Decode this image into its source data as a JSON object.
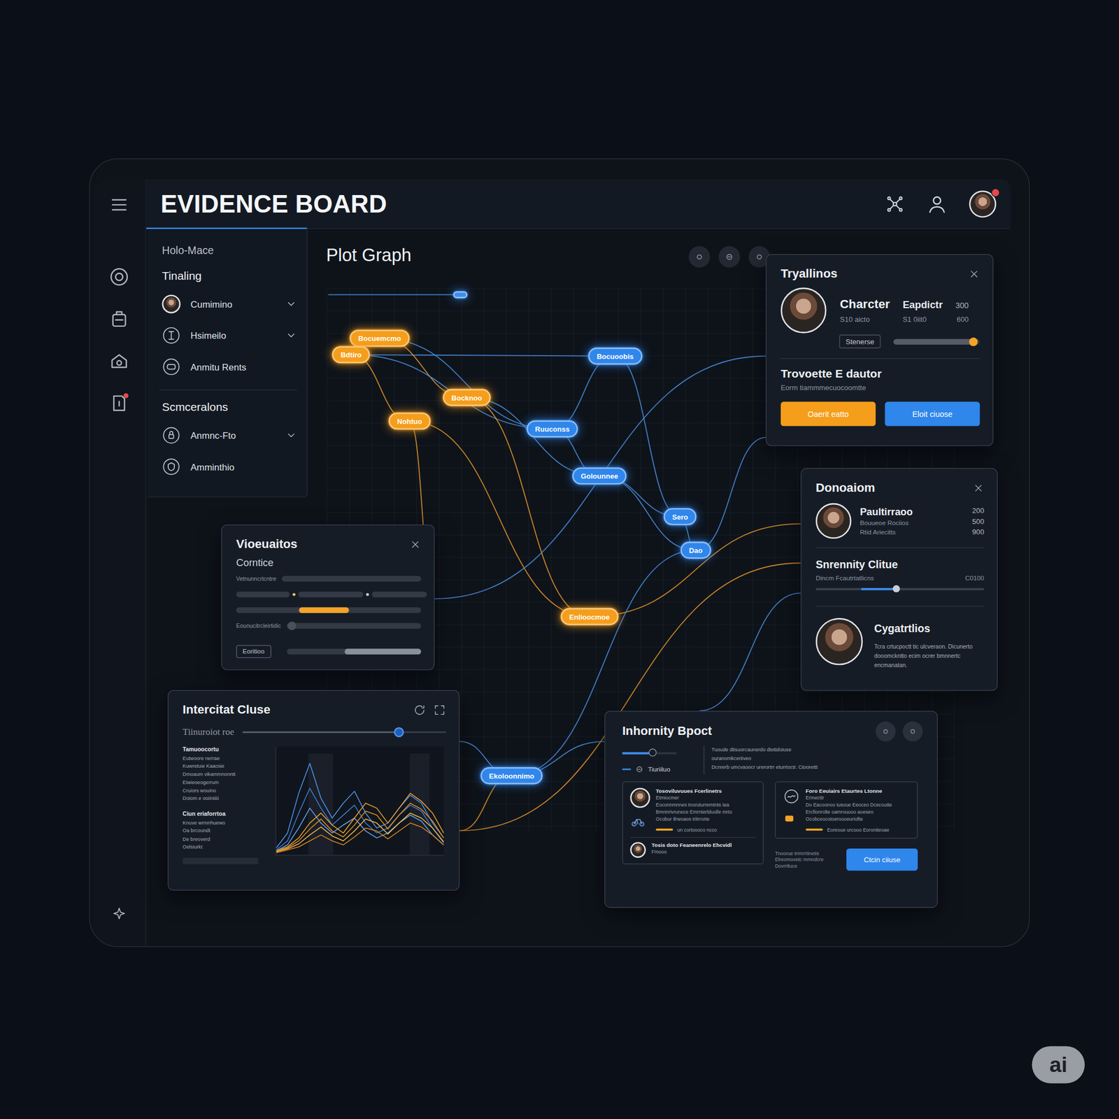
{
  "window": {
    "title": "EVIDENCE BOARD"
  },
  "header": {
    "notification": true
  },
  "rail": {
    "items": [
      {
        "selected": false,
        "alert": false
      },
      {
        "selected": false,
        "alert": false
      },
      {
        "selected": false,
        "alert": false
      },
      {
        "selected": false,
        "alert": true
      }
    ]
  },
  "panel": {
    "items": [
      {
        "kind": "caption",
        "label": "Holo-Mace"
      },
      {
        "kind": "heading",
        "label": "Tinaling"
      },
      {
        "kind": "avatar",
        "label": "Cumimino",
        "expanded": false
      },
      {
        "kind": "entry",
        "label": "Hsimeilo",
        "expanded": false
      },
      {
        "kind": "entry",
        "label": "Anmitu Rents"
      },
      {
        "kind": "divider"
      },
      {
        "kind": "heading",
        "label": "Scmceralons"
      },
      {
        "kind": "entry",
        "label": "Anmnc-Fto",
        "expanded": false
      },
      {
        "kind": "entry",
        "label": "Amminthio"
      }
    ]
  },
  "graph": {
    "title": "Plot Graph",
    "nodes": [
      {
        "kind": "dot",
        "color": "#3b8ef0"
      },
      {
        "kind": "pill",
        "label": "Bocuemcmo",
        "color": "#f59e1b"
      },
      {
        "kind": "pill",
        "label": "Bdtiro",
        "color": "#f59e1b"
      },
      {
        "kind": "pill",
        "label": "Bocknoo",
        "color": "#f59e1b"
      },
      {
        "kind": "pill",
        "label": "Nohtuo",
        "color": "#f59e1b"
      },
      {
        "kind": "pill",
        "label": "Bocuoobis",
        "color": "#2f86eb"
      },
      {
        "kind": "pill",
        "label": "Ruuconss",
        "color": "#2f86eb"
      },
      {
        "kind": "pill",
        "label": "Golounnee",
        "color": "#2f86eb"
      },
      {
        "kind": "pill",
        "label": "Sero",
        "color": "#2f86eb"
      },
      {
        "kind": "pill",
        "label": "Dao",
        "color": "#2f86eb"
      },
      {
        "kind": "pill",
        "label": "Enlioocmoe",
        "color": "#f59e1b"
      },
      {
        "kind": "pill",
        "label": "Ekoloonnimo",
        "color": "#2f86eb"
      }
    ],
    "edges": [
      {
        "from": "canvas-left",
        "to": 0,
        "color": "#4a8fe0"
      },
      {
        "from": 2,
        "to": 5,
        "color": "#4a8fe0"
      },
      {
        "from": 1,
        "to": 3,
        "color": "#e8962a"
      },
      {
        "from": 2,
        "to": 4,
        "color": "#e8962a"
      },
      {
        "from": 2,
        "to": 6,
        "color": "#4a8fe0"
      },
      {
        "from": 1,
        "to": 6,
        "color": "#4a8fe0"
      },
      {
        "from": 3,
        "to": 7,
        "color": "#4a8fe0"
      },
      {
        "from": 5,
        "to": 6,
        "color": "#4a8fe0"
      },
      {
        "from": 5,
        "to": 8,
        "color": "#4a8fe0"
      },
      {
        "from": 6,
        "to": 7,
        "color": "#4a8fe0"
      },
      {
        "from": 7,
        "to": 8,
        "color": "#4a8fe0"
      },
      {
        "from": 7,
        "to": 9,
        "color": "#4a8fe0"
      },
      {
        "from": 8,
        "to": 9,
        "color": "#4a8fe0"
      },
      {
        "from": 4,
        "to": 10,
        "color": "#e8962a"
      },
      {
        "from": 3,
        "to": 10,
        "color": "#e8962a"
      },
      {
        "from": 4,
        "to": "vioeu",
        "color": "#e8962a"
      },
      {
        "from": 10,
        "to": "donoaiom-a",
        "color": "#e8962a"
      },
      {
        "from": "inter-b",
        "to": "donoaiom-b",
        "color": "#e8962a"
      },
      {
        "from": 11,
        "to": "inter-a",
        "color": "#4a8fe0"
      },
      {
        "from": 11,
        "to": "inter-b",
        "color": "#e8962a"
      },
      {
        "from": 11,
        "to": "inhorn-a",
        "color": "#4a8fe0"
      },
      {
        "from": 9,
        "to": "tryallinos-b",
        "color": "#4a8fe0"
      },
      {
        "from": "vioeu",
        "to": "tryallinos-a",
        "color": "#4a8fe0"
      },
      {
        "from": "inhorn-top",
        "to": "donoaiom-c",
        "color": "#4a8fe0"
      },
      {
        "from": 9,
        "to": 11,
        "color": "#4a8fe0"
      }
    ]
  },
  "cards": {
    "tryallinos": {
      "title": "Tryallinos",
      "rows": [
        [
          "Charcter",
          "Eapdictr",
          "300"
        ],
        [
          "S10 aicto",
          "S1 0iit0",
          "600"
        ]
      ],
      "tag": "Stenerse",
      "level": 0.93,
      "section_title": "Trovoette E dautor",
      "section_text": "Eorm tiammmecuocoomtte",
      "buttons": [
        {
          "label": "Oaerit eatto",
          "color": "#f59e1b"
        },
        {
          "label": "Eloit ciuose",
          "color": "#2f86eb"
        }
      ]
    },
    "donoaiom": {
      "title": "Donoaiom",
      "person": {
        "name": "Paultirraoo",
        "lines": [
          "Bouueoe Rociios",
          "Rtid Ariecitts"
        ],
        "values": [
          "200",
          "500",
          "900"
        ]
      },
      "clue": {
        "title": "Snrennity Clitue",
        "label": "Dincm Fcautrtatlicns",
        "reading": "C0100",
        "start": 0.27,
        "level": 0.48
      },
      "profile": {
        "name": "Cygatrtlios",
        "text": "Tcra crtucpoctt tic ulcveraon. Dicunerto dooomckntto ecim ocrer bmnnertc encmanatan."
      }
    },
    "vioeuaitos": {
      "title": "Vioeuaitos",
      "subtitle": "Corntice",
      "rows": [
        {
          "kind": "track",
          "label": "Vetnunncrtcntre"
        },
        {
          "kind": "segments",
          "parts": [
            0.29,
            0.35,
            0.3
          ]
        },
        {
          "kind": "range",
          "start": 0.34,
          "level": 0.27
        },
        {
          "kind": "knob",
          "label": "Eounucitrcleirtidic",
          "level": 0.04
        },
        {
          "kind": "button",
          "label": "Eoritioo",
          "start": 0.43,
          "level": 0.57
        }
      ]
    },
    "intercitat": {
      "title": "Intercitat Cluse",
      "slider": {
        "label": "Tiinuroiot roe",
        "level": 0.77
      },
      "groups": [
        {
          "heading": "Tamuoocortu",
          "lines": [
            "Eutwoore nerrae",
            "Kuwretuie Kaaosie",
            "Dmoaum vikammnonntt",
            "Eiwieoeogerrum",
            "Cruiors wouino",
            "Doiom e ooiiniiiii"
          ]
        },
        {
          "heading": "Ciun eriaforrtoa",
          "lines": [
            "Knuve wrmnhuewo",
            "Oa brcoundt",
            "De breoverd",
            "Oelsiurkt"
          ]
        }
      ],
      "chart": {
        "series": [
          {
            "color": "#4f93ea",
            "values": [
              5,
              20,
              60,
              90,
              55,
              35,
              50,
              62,
              40,
              25,
              30,
              45,
              58,
              50,
              30,
              15
            ]
          },
          {
            "color": "#3f7fd6",
            "values": [
              3,
              12,
              40,
              65,
              45,
              28,
              38,
              48,
              30,
              20,
              25,
              38,
              48,
              42,
              25,
              10
            ]
          },
          {
            "color": "#6aa6f0",
            "values": [
              2,
              8,
              25,
              45,
              30,
              20,
              28,
              35,
              22,
              15,
              20,
              30,
              38,
              32,
              18,
              8
            ]
          },
          {
            "color": "#f5a329",
            "values": [
              2,
              6,
              15,
              30,
              40,
              28,
              20,
              35,
              50,
              45,
              30,
              45,
              60,
              52,
              40,
              20
            ]
          },
          {
            "color": "#e58f1d",
            "values": [
              1,
              5,
              12,
              24,
              34,
              22,
              16,
              28,
              42,
              38,
              24,
              38,
              50,
              44,
              32,
              15
            ]
          },
          {
            "color": "#f7b84a",
            "values": [
              1,
              4,
              9,
              18,
              26,
              17,
              12,
              22,
              34,
              30,
              19,
              30,
              40,
              35,
              25,
              11
            ]
          },
          {
            "color": "#d9841a",
            "values": [
              0,
              3,
              6,
              12,
              18,
              12,
              8,
              16,
              25,
              22,
              14,
              22,
              30,
              26,
              18,
              8
            ]
          }
        ]
      }
    },
    "inhornity": {
      "title": "Inhornity Bpoct",
      "slider": {
        "level": 0.55
      },
      "tag": "Tiuriiluo",
      "notes": [
        "Tuoude dtisuorcaunerdo dtettdoiuse",
        "ouranomkcertiveo",
        "Dcnrerb umcvaoocr urerortrr eturrtoctr. Ctoorettt"
      ],
      "subcards": [
        {
          "title": "Tosoviluvuues Fcerlinetrs",
          "lines": [
            "Etmiocmer",
            "Eoconnmnnes tnoruturremtnts tea",
            "Bmnnrivrunece Emrnterlduolle mrto",
            "Ocobur tlrwoaos tritrrorte"
          ],
          "footnote": "un cortoooco ncco",
          "extra": {
            "title": "Tosis doto Feaneenrelo Ehcvidl",
            "line": "Fmooo"
          }
        },
        {
          "title": "Foro Eeuiairs Etaurtes Ltonne",
          "lines": [
            "Ermecttr",
            "Do Eacoonoo tusoue Eeoceo Dcecoutte",
            "Ercfionrolte oamrouuoo aoeseo",
            "Ocobceocotoeroooeuriofte"
          ],
          "footnote": "Eoreoue urcooo Eoroniteoae"
        }
      ],
      "button_notes": [
        "Tnoorue trrmrrtinetis",
        "Elreomovetc mmndcre",
        "Dovrrtluce"
      ],
      "button": "Ctcin ciiuse"
    }
  },
  "watermark": {
    "label": "ai"
  }
}
